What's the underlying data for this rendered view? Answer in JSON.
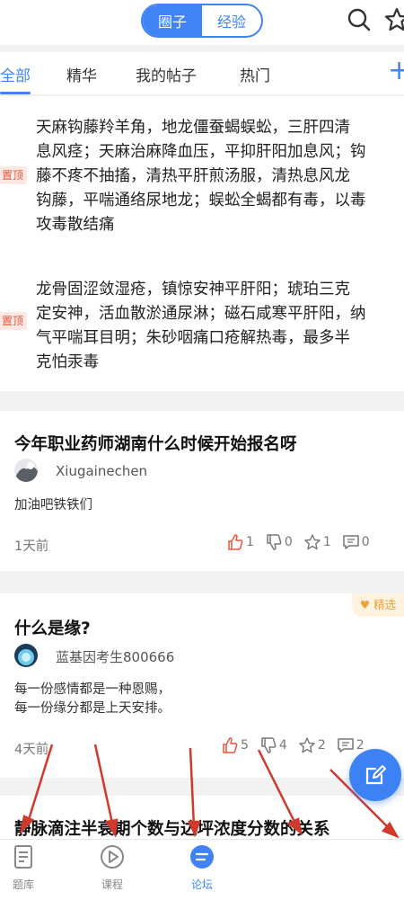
{
  "header": {
    "segment_active": "圈子",
    "segment_inactive": "经验"
  },
  "tabs": [
    {
      "label": "全部",
      "active": true
    },
    {
      "label": "精华",
      "active": false
    },
    {
      "label": "我的帖子",
      "active": false
    },
    {
      "label": "热门",
      "active": false
    }
  ],
  "pinned": [
    {
      "badge": "置顶",
      "text": "天麻钩藤羚羊角，地龙僵蚕蝎蜈蚣，三肝四清\n息风痉；天麻治麻降血压，平抑肝阳加息风；钩\n藤不疼不抽搐，清热平肝煎汤服，清热息风龙\n钩藤，平喘通络尿地龙；蜈蚣全蝎都有毒，以毒\n攻毒散结痛"
    },
    {
      "badge": "置顶",
      "text": "龙骨固涩敛湿疮，镇惊安神平肝阳；琥珀三克\n定安神，活血散淤通尿淋；磁石咸寒平肝阳，纳\n气平喘耳目明；朱砂咽痛口疮解热毒，最多半\n克怕汞毒"
    }
  ],
  "posts": [
    {
      "title": "今年职业药师湖南什么时候开始报名呀",
      "username": "Xiugainechen",
      "body": "加油吧铁铁们",
      "time": "1天前",
      "likes": "1",
      "dislikes": "0",
      "favorites": "1",
      "comments": "0",
      "featured": false
    },
    {
      "title": "什么是缘?",
      "username": "蓝基因考生800666",
      "body": "每一份感情都是一种恩赐，\n每一份缘分都是上天安排。",
      "time": "4天前",
      "likes": "5",
      "dislikes": "4",
      "favorites": "2",
      "comments": "2",
      "featured": true,
      "featured_label": "精选"
    },
    {
      "title": "静脉滴注半衰期个数与达坪浓度分数的关系"
    }
  ],
  "bottom_nav": [
    {
      "label": "题库",
      "icon": "document-list-icon",
      "active": false
    },
    {
      "label": "课程",
      "icon": "play-circle-icon",
      "active": false
    },
    {
      "label": "论坛",
      "icon": "chat-bubble-icon",
      "active": true
    }
  ],
  "colors": {
    "accent": "#3f83f4",
    "pin_badge": "#e9553b",
    "featured": "#e8a33c",
    "arrow": "#d0392b"
  }
}
